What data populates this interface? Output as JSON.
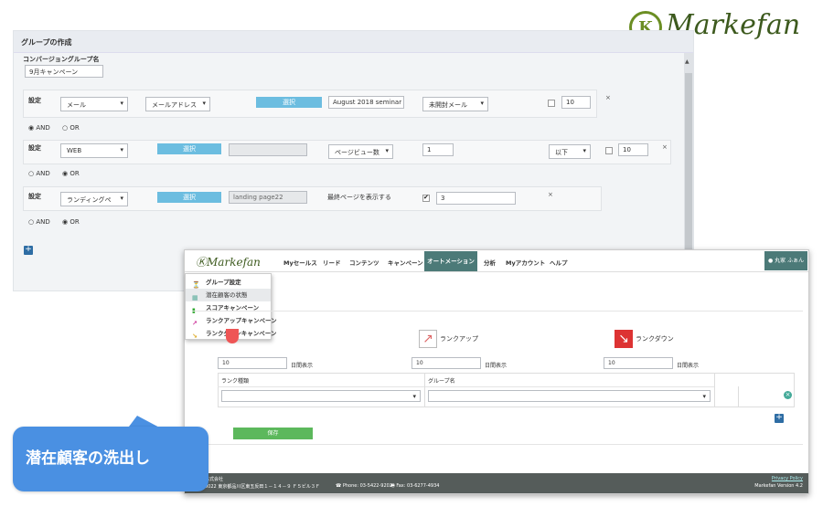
{
  "brand": {
    "logo_mark": "K",
    "logo_text": "Markefan"
  },
  "panel1": {
    "title": "グループの作成",
    "group_name_label": "コンバージョングループ名",
    "group_name_value": "9月キャンペーン",
    "rows": [
      {
        "label": "設定",
        "type": "メール",
        "field": "メールアドレス",
        "btn": "選択",
        "value": "August 2018 seminar",
        "condition": "未開封メール",
        "check": false,
        "count": "10",
        "x": "×"
      },
      {
        "label": "設定",
        "type": "WEB",
        "btn": "選択",
        "value": "",
        "field": "ページビュー数",
        "count_a": "1",
        "cmp": "以下",
        "check": false,
        "count": "10",
        "x": "×"
      },
      {
        "label": "設定",
        "type": "ランディングペ",
        "btn": "選択",
        "value": "landing page22",
        "text": "最終ページを表示する",
        "check": true,
        "count": "3",
        "x": "×"
      }
    ],
    "logic": [
      {
        "and": "AND",
        "or": "OR",
        "selected": "AND"
      },
      {
        "and": "AND",
        "or": "OR",
        "selected": "OR"
      },
      {
        "and": "AND",
        "or": "OR",
        "selected": "OR"
      }
    ],
    "add": "+"
  },
  "panel2": {
    "nav_logo": "Markefan",
    "nav": [
      "Myセールス",
      "リード",
      "コンテンツ",
      "キャンペーン",
      "オートメーション",
      "分析",
      "Myアカウント",
      "ヘルプ"
    ],
    "active": "オートメーション",
    "user": "丸家 ふぁん",
    "menu": [
      {
        "icon": "⏳",
        "label": "グループ設定",
        "hl": false
      },
      {
        "icon": "▦",
        "label": "潜在顧客の状態",
        "hl": true
      },
      {
        "icon": "▮",
        "label": "スコアキャンペーン",
        "hl": false
      },
      {
        "icon": "↗",
        "label": "ランクアップキャンペーン",
        "hl": false
      },
      {
        "icon": "↘",
        "label": "ランクダウンキャンペーン",
        "hl": false
      }
    ],
    "rank_up": "ランクアップ",
    "rank_down": "ランクダウン",
    "days_value": "10",
    "days_label": "日間表示",
    "col_rank": "ランク種類",
    "col_group": "グループ名",
    "save": "保存",
    "footer_left": "株式会社",
    "footer_addr": "0022 東京都品川区東五反田１－１４－９ Ｆ５ビル３Ｆ",
    "phone": "Phone: 03-5422-9202",
    "fax": "Fax: 03-6277-4934",
    "privacy": "Privacy Policy",
    "version": "Markefan Version 4.2",
    "close": "×",
    "add": "+"
  },
  "callout": "潜在顧客の洗出し",
  "colors": {
    "accent": "#4a90e2",
    "nav_active": "#4c7a78",
    "select_btn": "#6cbde0",
    "save": "#5cb85c"
  }
}
